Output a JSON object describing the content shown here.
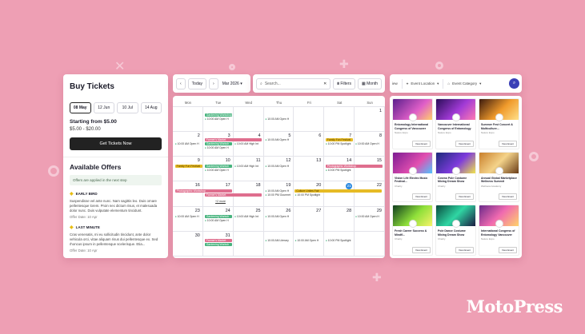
{
  "buy": {
    "title": "Buy Tickets",
    "dates": [
      "08 May",
      "12 Jun",
      "10 Jul",
      "14 Aug"
    ],
    "selected_date": "08 May",
    "starting": "Starting from $5.00",
    "range": "$5.00 - $20.00",
    "get_tickets": "Get Tickets Now",
    "offers_title": "Available Offers",
    "note": "Offers are applied in the next step",
    "offers": [
      {
        "title": "EARLY BIRD",
        "desc": "Suspendisse vel ante nunc. Nam sagittis leo. Duis ornare pellentesque lorem. Proin nec dictum risus, et malesuada dolor nunc. Duis vulputate elementum tincidunt.",
        "date": "Offer Date: 10 Apr"
      },
      {
        "title": "LAST MINUTE",
        "desc": "Cras venenatis, mi eu sollicitudin tincidunt, ante dolor vehicula orci, vitae aliquam risus dui pellentesque ex. Sed rhoncus ipsum in pellentesque scelerisque. Etia...",
        "date": "Offer Date: 10 Apr"
      }
    ]
  },
  "calendar": {
    "today_label": "Today",
    "month_label": "Mar 2026",
    "search_placeholder": "Search...",
    "filters_label": "Filters",
    "view_label": "Month",
    "weekdays": [
      "Mon",
      "Tue",
      "Wed",
      "Thu",
      "Fri",
      "Sat",
      "Sun"
    ],
    "weeks": [
      [
        "",
        "",
        "",
        "",
        "",
        "",
        "1"
      ],
      [
        "2",
        "3",
        "4",
        "5",
        "6",
        "7",
        "8"
      ],
      [
        "9",
        "10",
        "11",
        "12",
        "13",
        "14",
        "15"
      ],
      [
        "16",
        "17",
        "18",
        "19",
        "20",
        "21",
        "22"
      ],
      [
        "23",
        "24",
        "25",
        "26",
        "27",
        "28",
        "29"
      ],
      [
        "30",
        "31",
        "",
        "",
        "",
        "",
        ""
      ]
    ],
    "today_day": "19",
    "more_label": "+2 more",
    "events": {
      "w0_green": "Gardening Workshop",
      "w0_dot_tue": "10:00 AM Open H",
      "w0_dot_thu": "10:00 AM Open H",
      "w1_pink": "Farmer's Market",
      "w1_green": "Gardening Worksh",
      "w1_dot_mon": "10:00 AM Open H",
      "w1_dot_tue": "10:00 AM Open H",
      "w1_dot_wed": "10:00 AM High Int",
      "w1_dot_thu": "10:00 AM Open H",
      "w1_yellow": "Family Fun Festival",
      "w1_dot_sat": "10:00 PM Spotlight",
      "w1_dot_sun": "10:00 AM Open H",
      "w2_yellow": "Family Fun Festival",
      "w2_green": "Gardening Worksh",
      "w2_dot_tue": "10:00 AM Open H",
      "w2_dot_wed": "10:00 AM High Int",
      "w2_dot_thu": "10:00 AM Open H",
      "w2_pink": "Photographic Workshop",
      "w2_dot_sat": "10:00 PM Spotlight",
      "w3_pink": "Photographic Workshop",
      "w3_pink2": "Farmer's Market",
      "w3_dot_thu": "10:00 AM Open H",
      "w3_dot_fri": "10:00 PM Gourmet",
      "w3_yellow": "Culture Unites Fair",
      "w3_dot_sat": "10:00 PM Spotlight",
      "w4_green": "Gardening Worksh",
      "w4_dot_mon": "10:00 AM Open H",
      "w4_dot_tue": "10:00 AM Open H",
      "w4_dot_wed": "10:00 AM High Int",
      "w4_dot_thu": "10:00 AM Open H",
      "w4_dot_sun": "10:00 AM Open H",
      "w5_pink": "Farmer's Market",
      "w5_green": "Gardening Worksh",
      "w5_dot_thu": "10:00 AM Literary",
      "w5_dot_fri": "10:00 AM Open H",
      "w5_dot_sat": "10:00 PM Spotlight"
    }
  },
  "filters": {
    "view_fragment": "iew",
    "location": "Event Location",
    "category": "Event Category"
  },
  "events": [
    {
      "title": "Entomology International Congress of Vancouver",
      "org": "Nature Expo",
      "btn": "View Event"
    },
    {
      "title": "Vancouver International Congress of Entomology",
      "org": "Nature Expo",
      "btn": "View Event"
    },
    {
      "title": "Summer Fest Concert & Multiculture...",
      "org": "Nature Expo",
      "btn": "View Event"
    },
    {
      "title": "Vision Life Electro Music Festival...",
      "org": "Charity",
      "btn": "View Event"
    },
    {
      "title": "Cosmo Pole Costume Mixing Dream Show",
      "org": "Charity",
      "btn": "View Event"
    },
    {
      "title": "Annual Global Marketplace Wellness Summit",
      "org": "Wellness Academy",
      "btn": "View Event"
    },
    {
      "title": "Fresh Career Success & Mindfl...",
      "org": "Charity",
      "btn": "View Event"
    },
    {
      "title": "Pole Dance Costume Mixing Dream Show",
      "org": "Charity",
      "btn": "View Event"
    },
    {
      "title": "International Congress of Entomology Vancouver",
      "org": "Nature Expo",
      "btn": "View Event"
    }
  ],
  "brand": "MotoPress",
  "colors": {
    "background": "#ee9fb4",
    "accent": "#3a3fb6",
    "green": "#46b37d",
    "pink": "#df6e8e",
    "yellow": "#e6bb25"
  }
}
